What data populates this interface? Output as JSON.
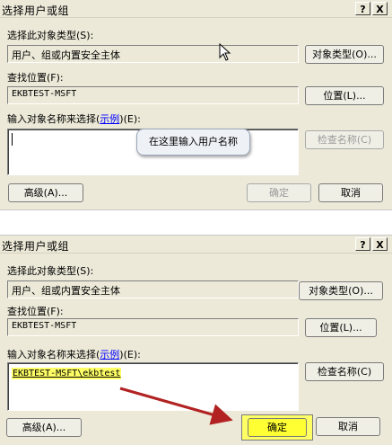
{
  "dialog1": {
    "title": "选择用户或组",
    "help_label": "?",
    "close_label": "X",
    "object_type_label": "选择此对象类型(S):",
    "object_type_value": "用户、组或内置安全主体",
    "object_type_button": "对象类型(O)...",
    "location_label": "查找位置(F):",
    "location_value": "EKBTEST-MSFT",
    "location_button": "位置(L)...",
    "names_label_prefix": "输入对象名称来选择(",
    "names_label_link": "示例",
    "names_label_suffix": ")(E):",
    "check_names_button": "检查名称(C)",
    "callout_text": "在这里输入用户名称",
    "advanced_button": "高级(A)...",
    "ok_button": "确定",
    "cancel_button": "取消"
  },
  "dialog2": {
    "title": "选择用户或组",
    "help_label": "?",
    "close_label": "X",
    "object_type_label": "选择此对象类型(S):",
    "object_type_value": "用户、组或内置安全主体",
    "object_type_button": "对象类型(O)...",
    "location_label": "查找位置(F):",
    "location_value": "EKBTEST-MSFT",
    "location_button": "位置(L)...",
    "names_label_prefix": "输入对象名称来选择(",
    "names_label_link": "示例",
    "names_label_suffix": ")(E):",
    "entered_name": "EKBTEST-MSFT\\ekbtest",
    "check_names_button": "检查名称(C)",
    "advanced_button": "高级(A)...",
    "ok_button": "确定",
    "cancel_button": "取消"
  },
  "colors": {
    "dialog_bg": "#ece9d8",
    "highlight": "#ffff66",
    "arrow": "#b22222",
    "link": "#0000ff"
  }
}
